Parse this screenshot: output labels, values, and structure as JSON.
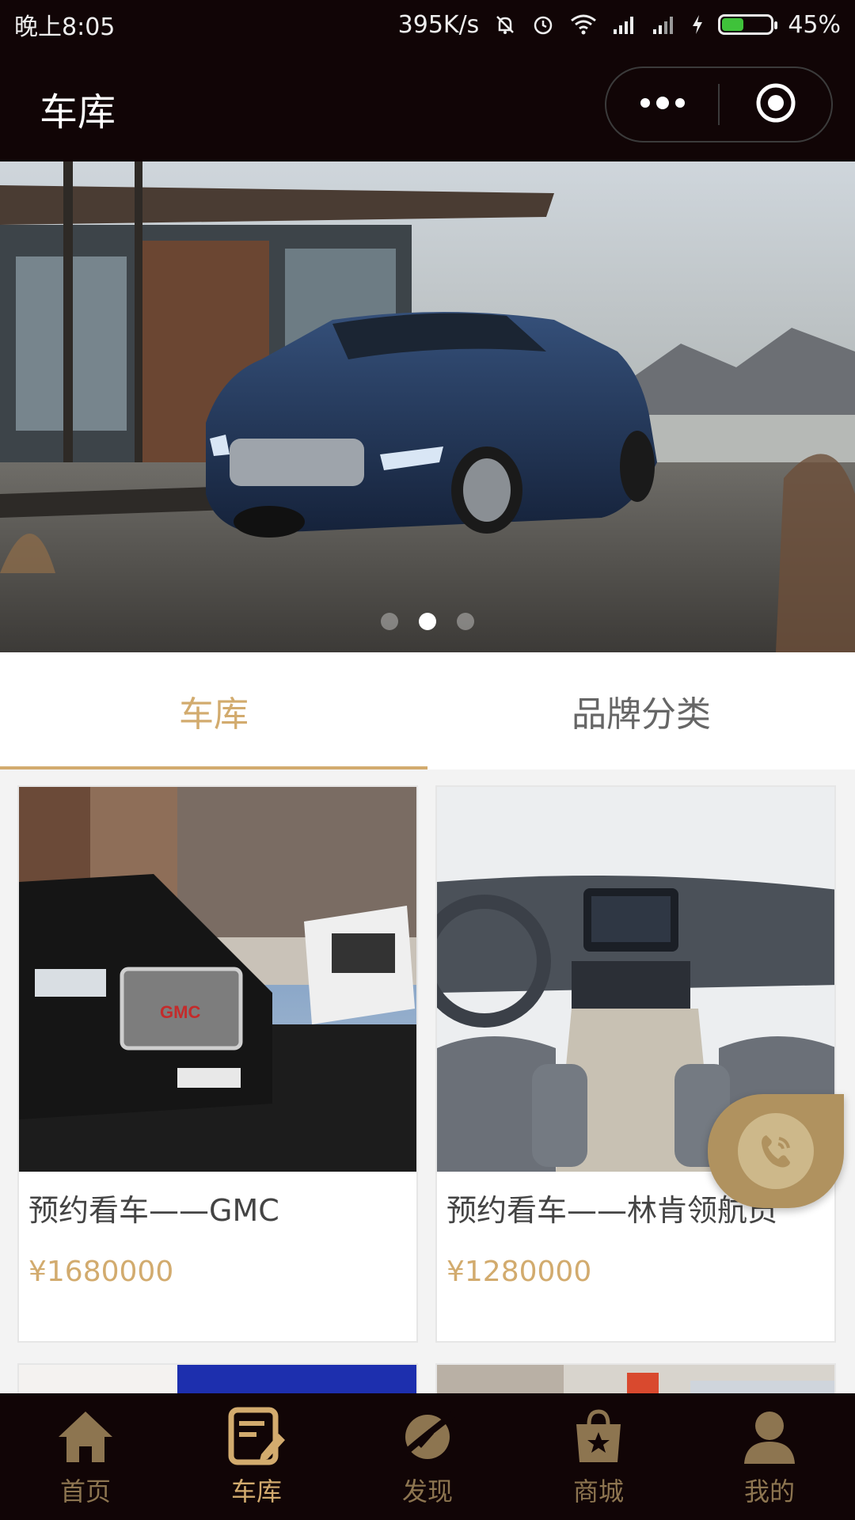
{
  "status_bar": {
    "time": "晚上8:05",
    "network_speed": "395K/s",
    "battery_percent": "45%",
    "battery_level": 0.45,
    "icons": [
      "mute-bell-icon",
      "alarm-icon",
      "wifi-icon",
      "signal-icon",
      "signal-icon",
      "charging-icon",
      "battery-icon"
    ]
  },
  "nav": {
    "title": "车库",
    "more_icon": "more-dots-icon",
    "close_icon": "target-circle-icon"
  },
  "banner": {
    "slide_count": 3,
    "active_index": 1
  },
  "tabs": [
    {
      "label": "车库",
      "active": true
    },
    {
      "label": "品牌分类",
      "active": false
    }
  ],
  "cars": [
    {
      "title": "预约看车——GMC",
      "price": "¥1680000"
    },
    {
      "title": "预约看车——林肯领航员",
      "price": "¥1280000"
    }
  ],
  "floating": {
    "call_icon": "phone-icon"
  },
  "tabbar": [
    {
      "label": "首页",
      "icon": "home-icon",
      "active": false
    },
    {
      "label": "车库",
      "icon": "edit-doc-icon",
      "active": true
    },
    {
      "label": "发现",
      "icon": "planet-icon",
      "active": false
    },
    {
      "label": "商城",
      "icon": "shopping-bag-star-icon",
      "active": false
    },
    {
      "label": "我的",
      "icon": "user-icon",
      "active": false
    }
  ],
  "colors": {
    "dark_bg": "#110506",
    "accent_gold": "#d2ab6e",
    "inactive_gold": "#8d7550"
  }
}
